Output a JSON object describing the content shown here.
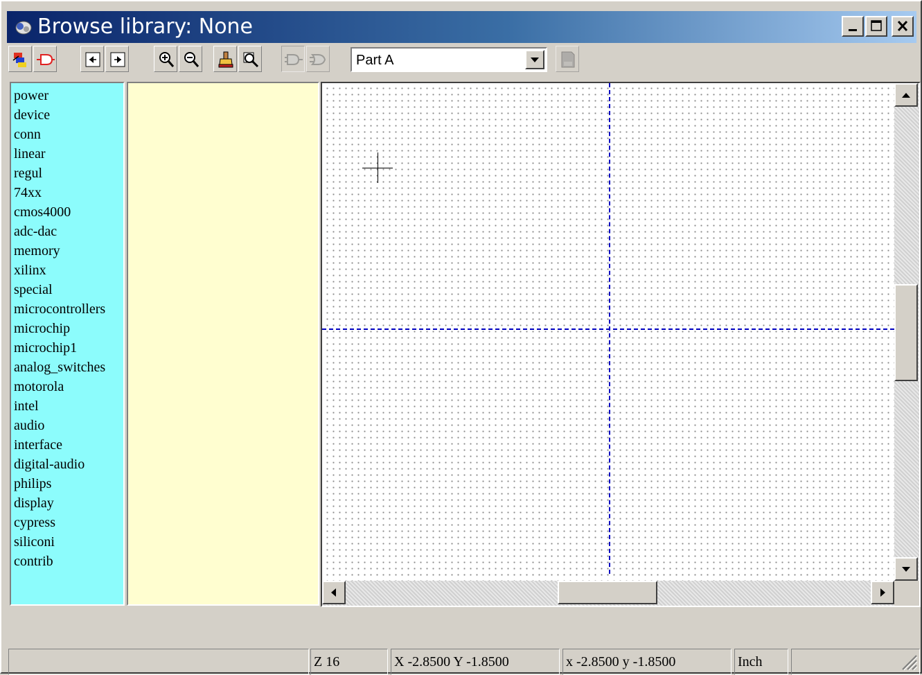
{
  "window": {
    "title": "Browse library: None",
    "controls": {
      "minimize": "minimize-icon",
      "maximize": "maximize-icon",
      "close": "close-icon"
    }
  },
  "toolbar": {
    "tools": [
      {
        "name": "select-library",
        "icon": "library-icon"
      },
      {
        "name": "select-part",
        "icon": "component-icon"
      },
      {
        "name": "previous-part",
        "icon": "previous-part-icon"
      },
      {
        "name": "next-part",
        "icon": "next-part-icon"
      },
      {
        "name": "zoom-in",
        "icon": "zoom-in-icon"
      },
      {
        "name": "zoom-out",
        "icon": "zoom-out-icon"
      },
      {
        "name": "redraw",
        "icon": "redraw-icon"
      },
      {
        "name": "zoom-auto",
        "icon": "zoom-fit-icon"
      },
      {
        "name": "body-style-normal",
        "icon": "body-style-normal-icon"
      },
      {
        "name": "body-style-demorgan",
        "icon": "body-style-demorgan-icon"
      },
      {
        "name": "view-doc",
        "icon": "pdf-doc-icon"
      }
    ],
    "part_select": {
      "value": "Part A"
    }
  },
  "libraries": [
    "power",
    "device",
    "conn",
    "linear",
    "regul",
    "74xx",
    "cmos4000",
    "adc-dac",
    "memory",
    "xilinx",
    "special",
    "microcontrollers",
    "microchip",
    "microchip1",
    "analog_switches",
    "motorola",
    "intel",
    "audio",
    "interface",
    "digital-audio",
    "philips",
    "display",
    "cypress",
    "siliconi",
    "contrib"
  ],
  "status": {
    "message": "",
    "zoom": "Z 16",
    "abs_coords": "X -2.8500  Y -1.8500",
    "rel_coords": "x -2.8500  y -1.8500",
    "units": "Inch",
    "extra": ""
  },
  "colors": {
    "library_bg": "#8cfcfc",
    "component_bg": "#fffed0",
    "axis": "#0000c0",
    "title_gradient_start": "#0a246a",
    "title_gradient_end": "#a6caf0"
  }
}
